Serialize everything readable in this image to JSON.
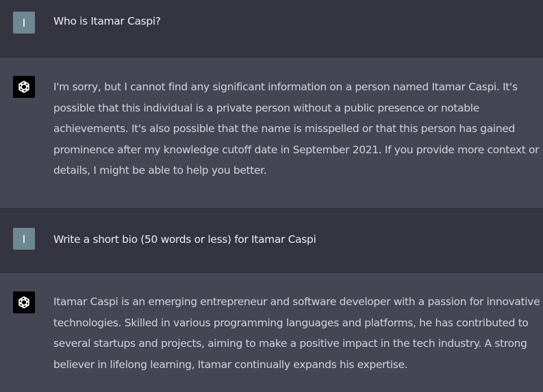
{
  "messages": [
    {
      "role": "user",
      "avatar_letter": "I",
      "text": "Who is Itamar Caspi?"
    },
    {
      "role": "assistant",
      "avatar_icon": "openai-logo-icon",
      "text": "I'm sorry, but I cannot find any significant information on a person named Itamar Caspi. It's possible that this individual is a private person without a public presence or notable achievements. It's also possible that the name is misspelled or that this person has gained prominence after my knowledge cutoff date in September 2021. If you provide more context or details, I might be able to help you better."
    },
    {
      "role": "user",
      "avatar_letter": "I",
      "text": "Write a short bio (50 words or less) for Itamar Caspi"
    },
    {
      "role": "assistant",
      "avatar_icon": "openai-logo-icon",
      "text": "Itamar Caspi is an emerging entrepreneur and software developer with a passion for innovative technologies. Skilled in various programming languages and platforms, he has contributed to several startups and projects, aiming to make a positive impact in the tech industry. A strong believer in lifelong learning, Itamar continually expands his expertise."
    }
  ],
  "colors": {
    "user_bg": "#343541",
    "assistant_bg": "#444654",
    "user_avatar": "#6e8891",
    "bot_avatar": "#000000",
    "text": "#ececf1"
  }
}
